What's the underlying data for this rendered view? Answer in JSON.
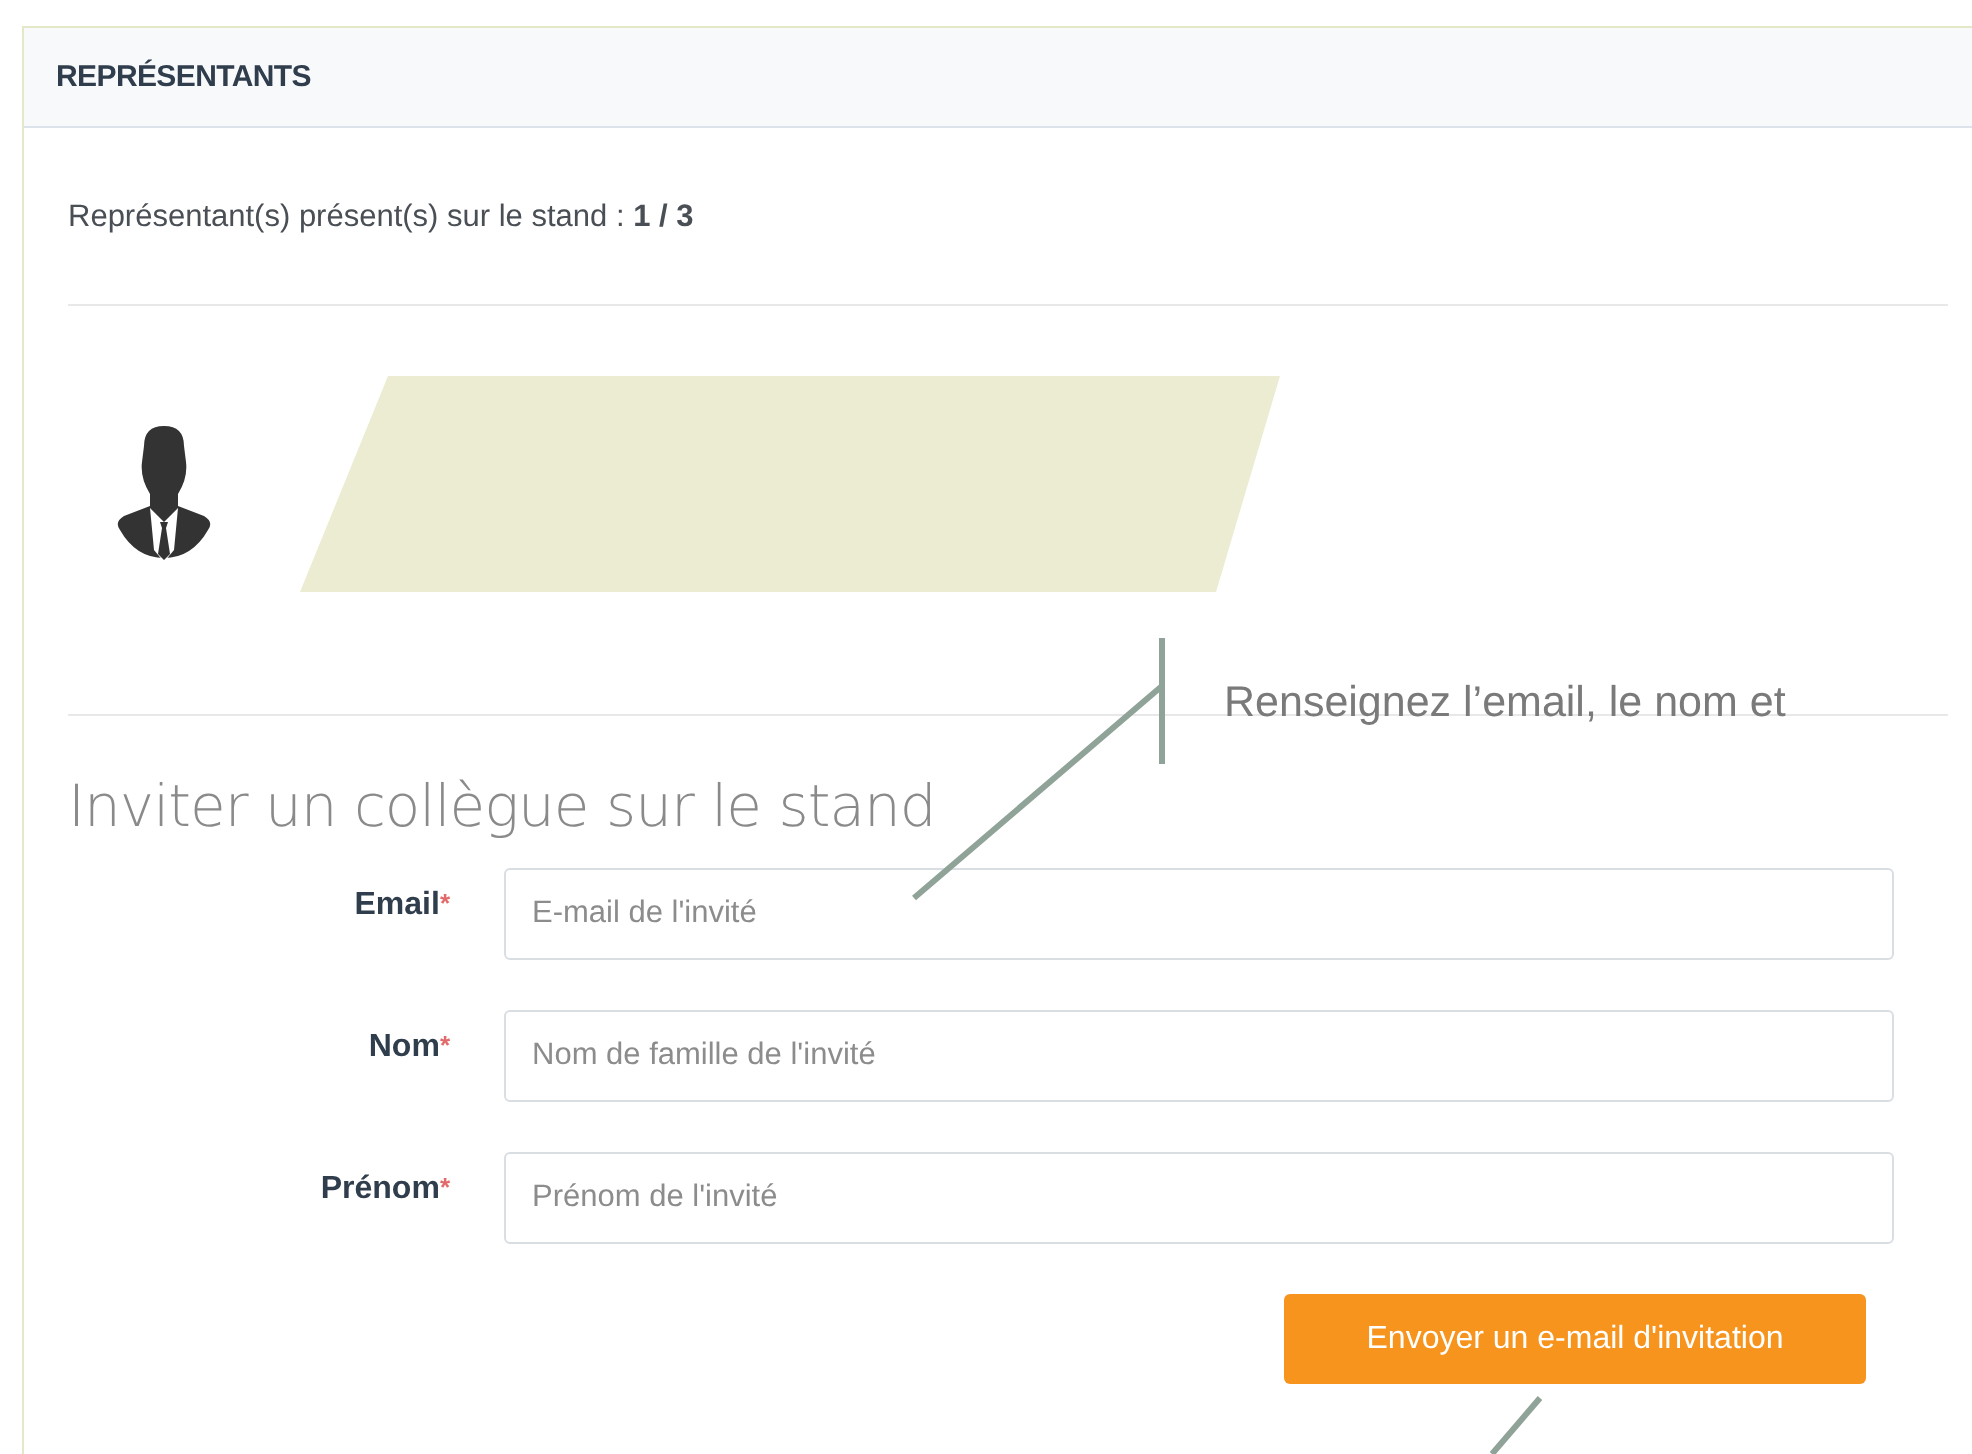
{
  "panel": {
    "title": "REPRÉSENTANTS",
    "present_text": "Représentant(s) présent(s) sur le stand : **1 / 3**"
  },
  "invite": {
    "heading": "Inviter un collègue sur le stand",
    "fields": [
      {
        "label": "Email",
        "mark": "*",
        "placeholder": "E-mail de l'invité"
      },
      {
        "label": "Nom",
        "mark": "*",
        "placeholder": "Nom de famille de l'invité"
      },
      {
        "label": "Prénom",
        "mark": "*",
        "placeholder": "Prénom de l'invité"
      }
    ],
    "button": "Envoyer un e-mail d'invitation"
  },
  "annotation": {
    "text": "Renseignez l’email, le nom et"
  }
}
